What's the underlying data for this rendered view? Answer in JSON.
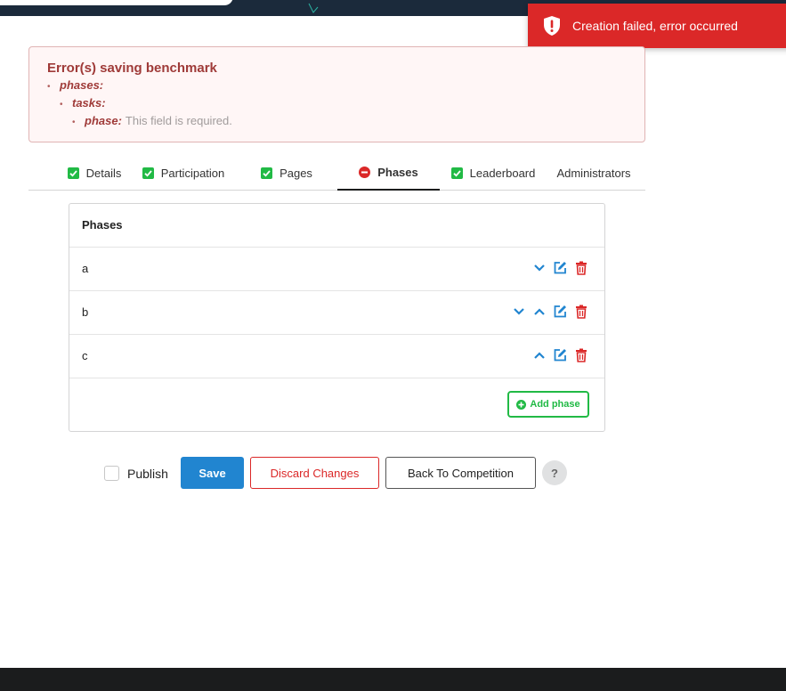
{
  "toast": {
    "message": "Creation failed, error occurred",
    "color": "#db2828",
    "icon": "exclamation-shield-icon"
  },
  "errors": {
    "title": "Error(s) saving benchmark",
    "items": [
      {
        "key": "phases:",
        "msg": ""
      },
      {
        "key": "tasks:",
        "msg": ""
      },
      {
        "key": "phase:",
        "msg": "This field is required."
      }
    ]
  },
  "tabs": [
    {
      "label": "Details",
      "status": "ok",
      "icon": "check-square-icon"
    },
    {
      "label": "Participation",
      "status": "ok",
      "icon": "check-square-icon"
    },
    {
      "label": "Pages",
      "status": "ok",
      "icon": "check-square-icon"
    },
    {
      "label": "Phases",
      "status": "error",
      "icon": "minus-circle-icon",
      "active": true
    },
    {
      "label": "Leaderboard",
      "status": "ok",
      "icon": "check-square-icon"
    },
    {
      "label": "Administrators",
      "status": "none"
    }
  ],
  "phases_panel": {
    "title": "Phases",
    "rows": [
      {
        "name": "a",
        "can_move_down": true,
        "can_move_up": false
      },
      {
        "name": "b",
        "can_move_down": true,
        "can_move_up": true
      },
      {
        "name": "c",
        "can_move_down": false,
        "can_move_up": true
      }
    ],
    "add_label": "Add phase"
  },
  "actions": {
    "publish_label": "Publish",
    "publish_checked": false,
    "save_label": "Save",
    "discard_label": "Discard Changes",
    "back_label": "Back To Competition",
    "help_label": "?"
  },
  "colors": {
    "accent_blue": "#2185d0",
    "error_red": "#db2828",
    "success_green": "#21ba45",
    "nav_dark": "#1b2a3b"
  }
}
